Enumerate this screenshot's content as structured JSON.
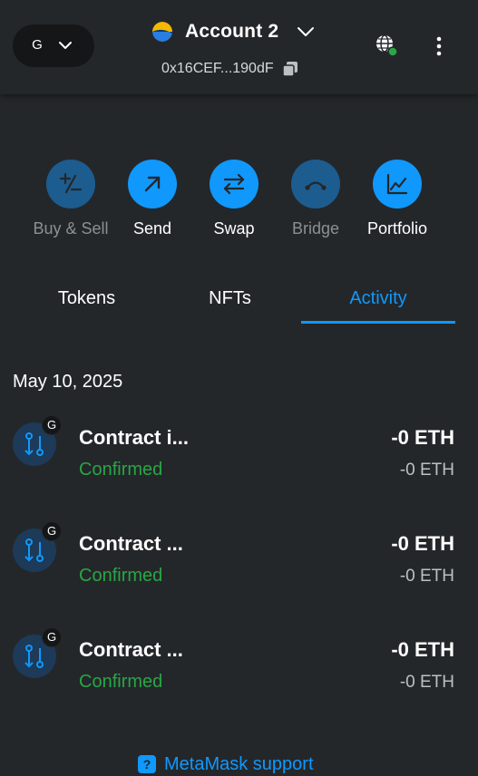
{
  "header": {
    "network_letter": "G",
    "account_name": "Account 2",
    "address": "0x16CEF...190dF"
  },
  "actions": [
    {
      "label": "Buy & Sell",
      "icon": "plus-minus-icon",
      "enabled": false
    },
    {
      "label": "Send",
      "icon": "arrow-up-right-icon",
      "enabled": true
    },
    {
      "label": "Swap",
      "icon": "swap-arrows-icon",
      "enabled": true
    },
    {
      "label": "Bridge",
      "icon": "bridge-icon",
      "enabled": false
    },
    {
      "label": "Portfolio",
      "icon": "chart-icon",
      "enabled": true
    }
  ],
  "tabs": [
    {
      "label": "Tokens",
      "active": false
    },
    {
      "label": "NFTs",
      "active": false
    },
    {
      "label": "Activity",
      "active": true
    }
  ],
  "activity": {
    "date": "May 10, 2025",
    "transactions": [
      {
        "title": "Contract i...",
        "status": "Confirmed",
        "amount": "-0 ETH",
        "fiat": "-0 ETH",
        "badge": "G"
      },
      {
        "title": "Contract ...",
        "status": "Confirmed",
        "amount": "-0 ETH",
        "fiat": "-0 ETH",
        "badge": "G"
      },
      {
        "title": "Contract ...",
        "status": "Confirmed",
        "amount": "-0 ETH",
        "fiat": "-0 ETH",
        "badge": "G"
      }
    ]
  },
  "footer": {
    "support_label": "MetaMask support",
    "support_icon": "?"
  },
  "colors": {
    "background": "#24272a",
    "accent": "#1098fc",
    "success": "#28a745",
    "muted_action": "#1d5c8f"
  }
}
